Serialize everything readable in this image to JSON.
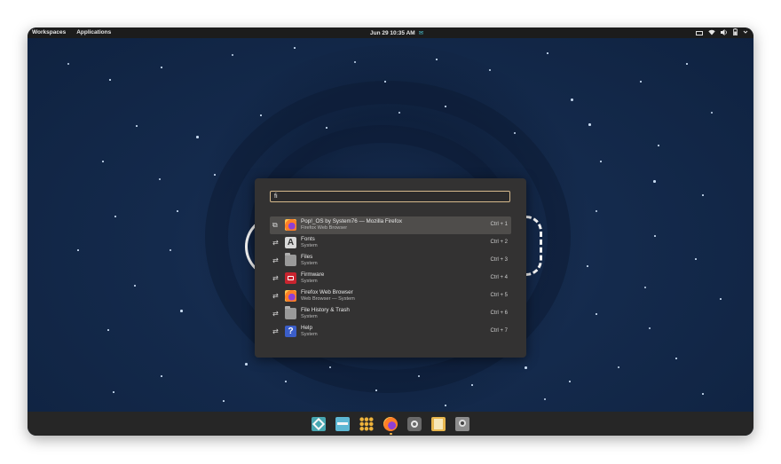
{
  "topbar": {
    "workspaces_label": "Workspaces",
    "applications_label": "Applications",
    "datetime": "Jun 29  10:35 AM",
    "notification_icon": "notification-icon"
  },
  "launcher": {
    "query": "fi",
    "results": [
      {
        "title": "Pop!_OS by System76 — Mozilla Firefox",
        "subtitle": "Firefox Web Browser",
        "shortcut": "Ctrl + 1",
        "icon": "firefox-icon",
        "selected": true
      },
      {
        "title": "Fonts",
        "subtitle": "System",
        "shortcut": "Ctrl + 2",
        "icon": "fonts-icon"
      },
      {
        "title": "Files",
        "subtitle": "System",
        "shortcut": "Ctrl + 3",
        "icon": "folder-icon"
      },
      {
        "title": "Firmware",
        "subtitle": "System",
        "shortcut": "Ctrl + 4",
        "icon": "firmware-icon"
      },
      {
        "title": "Firefox Web Browser",
        "subtitle": "Web Browser — System",
        "shortcut": "Ctrl + 5",
        "icon": "firefox-icon"
      },
      {
        "title": "File History & Trash",
        "subtitle": "System",
        "shortcut": "Ctrl + 6",
        "icon": "folder-icon"
      },
      {
        "title": "Help",
        "subtitle": "System",
        "shortcut": "Ctrl + 7",
        "icon": "help-icon"
      }
    ]
  },
  "dock": {
    "items": [
      "workspaces-icon",
      "launcher-icon",
      "applications-icon",
      "firefox-icon",
      "settings-icon",
      "files-icon",
      "disk-icon"
    ]
  }
}
